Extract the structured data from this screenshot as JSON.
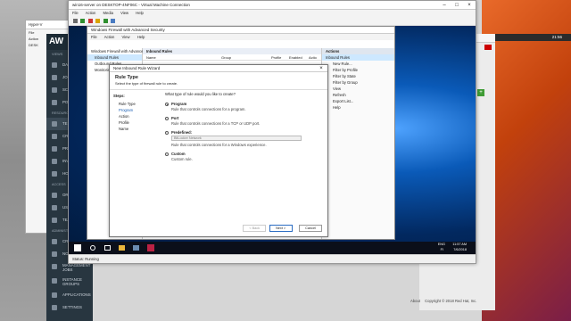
{
  "desktop_left_header": "Hyper-V",
  "desktop_left_items": [
    "File",
    "Action",
    "DESK"
  ],
  "recycle_label": "Recyc",
  "vm_window": {
    "title": "win16-server on DESKTOP-4NF06C - Virtual Machine Connection",
    "menu": [
      "File",
      "Action",
      "Media",
      "View",
      "Help"
    ]
  },
  "firewall": {
    "title": "Windows Firewall with Advanced Security",
    "menu": [
      "File",
      "Action",
      "View",
      "Help"
    ],
    "tree": [
      "Windows Firewall with Advance",
      "Inbound Rules",
      "Outbound Rules",
      "Monitoring"
    ],
    "center_header": "Inbound Rules",
    "columns": [
      "Name",
      "Group",
      "Profile",
      "Enabled",
      "Actio"
    ]
  },
  "actions": {
    "header": "Actions",
    "section": "Inbound Rules",
    "items": [
      "New Rule...",
      "Filter by Profile",
      "Filter by State",
      "Filter by Group",
      "View",
      "Refresh",
      "Export List...",
      "Help"
    ]
  },
  "wizard": {
    "title": "New Inbound Rule Wizard",
    "heading": "Rule Type",
    "subheading": "Select the type of firewall rule to create.",
    "steps_title": "Steps:",
    "steps": [
      "Rule Type",
      "Program",
      "Action",
      "Profile",
      "Name"
    ],
    "question": "What type of rule would you like to create?",
    "options": [
      {
        "label": "Program",
        "desc": "Rule that controls connections for a program."
      },
      {
        "label": "Port",
        "desc": "Rule that controls connections for a TCP or UDP port."
      },
      {
        "label": "Predefined:",
        "desc": "Rule that controls connections for a Windows experience."
      },
      {
        "label": "Custom",
        "desc": "Custom rule."
      }
    ],
    "predefined_value": "BitLocker Network",
    "back_label": "< Back",
    "next_label": "Next >",
    "cancel_label": "Cancel"
  },
  "taskbar": {
    "lang": "ENG",
    "region": "FI",
    "time": "11:57 AM",
    "date": "7/6/2018"
  },
  "status": "Status: Running",
  "left_app": {
    "logo": "AW",
    "items": [
      "DASH",
      "JOBS",
      "SCHE",
      "PORT",
      "TEMP",
      "CRED",
      "PROJ",
      "INVE",
      "HOS",
      "ORGA",
      "USER",
      "TEAM",
      "CRED",
      "NOTI",
      "MANAGEMENT JOBS",
      "INSTANCE GROUPS",
      "APPLICATIONS",
      "SETTINGS"
    ],
    "section_labels": [
      "VIEWS",
      "RESOURCES",
      "ACCESS",
      "ADMINISTRATION"
    ]
  },
  "right_panel": {
    "top_time": "21:56",
    "footer_about": "About",
    "footer_copyright": "Copyright © 2018 Red Hat, Inc."
  }
}
